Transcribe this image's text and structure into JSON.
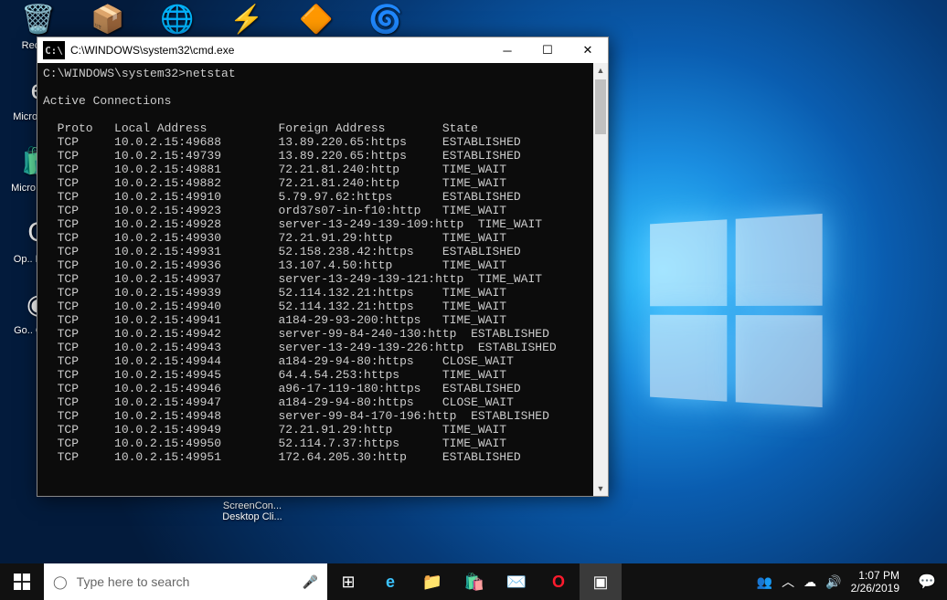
{
  "desktop": {
    "top_icons": [
      {
        "name": "recycle-bin",
        "label": "Recycle Bin",
        "glyph": "🗑️"
      },
      {
        "name": "jar",
        "label": "",
        "glyph": "📦"
      },
      {
        "name": "globe",
        "label": "",
        "glyph": "🌐"
      },
      {
        "name": "winamp",
        "label": "",
        "glyph": "⚡"
      },
      {
        "name": "vlc",
        "label": "",
        "glyph": "🔶"
      },
      {
        "name": "chrome-canary",
        "label": "",
        "glyph": "🌀"
      }
    ],
    "left_icons": [
      {
        "name": "recycle-bin",
        "label": "Recyc..",
        "glyph": "🗑️"
      },
      {
        "name": "edge",
        "label": "Micro.. Ed..",
        "glyph": "e"
      },
      {
        "name": "store",
        "label": "Micro.. Too..",
        "glyph": "🛍️"
      },
      {
        "name": "opera",
        "label": "Op.. Brow..",
        "glyph": "O"
      },
      {
        "name": "chrome",
        "label": "Go.. Chro..",
        "glyph": "◉"
      }
    ],
    "orphan_label": "ScreenCon...\nDesktop Cli..."
  },
  "cmd": {
    "title": "C:\\WINDOWS\\system32\\cmd.exe",
    "prompt": "C:\\WINDOWS\\system32>",
    "command": "netstat",
    "section_header": "Active Connections",
    "columns": [
      "Proto",
      "Local Address",
      "Foreign Address",
      "State"
    ],
    "rows": [
      [
        "TCP",
        "10.0.2.15:49688",
        "13.89.220.65:https",
        "ESTABLISHED"
      ],
      [
        "TCP",
        "10.0.2.15:49739",
        "13.89.220.65:https",
        "ESTABLISHED"
      ],
      [
        "TCP",
        "10.0.2.15:49881",
        "72.21.81.240:http",
        "TIME_WAIT"
      ],
      [
        "TCP",
        "10.0.2.15:49882",
        "72.21.81.240:http",
        "TIME_WAIT"
      ],
      [
        "TCP",
        "10.0.2.15:49910",
        "5.79.97.62:https",
        "ESTABLISHED"
      ],
      [
        "TCP",
        "10.0.2.15:49923",
        "ord37s07-in-f10:http",
        "TIME_WAIT"
      ],
      [
        "TCP",
        "10.0.2.15:49928",
        "server-13-249-139-109:http",
        "TIME_WAIT"
      ],
      [
        "TCP",
        "10.0.2.15:49930",
        "72.21.91.29:http",
        "TIME_WAIT"
      ],
      [
        "TCP",
        "10.0.2.15:49931",
        "52.158.238.42:https",
        "ESTABLISHED"
      ],
      [
        "TCP",
        "10.0.2.15:49936",
        "13.107.4.50:http",
        "TIME_WAIT"
      ],
      [
        "TCP",
        "10.0.2.15:49937",
        "server-13-249-139-121:http",
        "TIME_WAIT"
      ],
      [
        "TCP",
        "10.0.2.15:49939",
        "52.114.132.21:https",
        "TIME_WAIT"
      ],
      [
        "TCP",
        "10.0.2.15:49940",
        "52.114.132.21:https",
        "TIME_WAIT"
      ],
      [
        "TCP",
        "10.0.2.15:49941",
        "a184-29-93-200:https",
        "TIME_WAIT"
      ],
      [
        "TCP",
        "10.0.2.15:49942",
        "server-99-84-240-130:http",
        "ESTABLISHED"
      ],
      [
        "TCP",
        "10.0.2.15:49943",
        "server-13-249-139-226:http",
        "ESTABLISHED"
      ],
      [
        "TCP",
        "10.0.2.15:49944",
        "a184-29-94-80:https",
        "CLOSE_WAIT"
      ],
      [
        "TCP",
        "10.0.2.15:49945",
        "64.4.54.253:https",
        "TIME_WAIT"
      ],
      [
        "TCP",
        "10.0.2.15:49946",
        "a96-17-119-180:https",
        "ESTABLISHED"
      ],
      [
        "TCP",
        "10.0.2.15:49947",
        "a184-29-94-80:https",
        "CLOSE_WAIT"
      ],
      [
        "TCP",
        "10.0.2.15:49948",
        "server-99-84-170-196:http",
        "ESTABLISHED"
      ],
      [
        "TCP",
        "10.0.2.15:49949",
        "72.21.91.29:http",
        "TIME_WAIT"
      ],
      [
        "TCP",
        "10.0.2.15:49950",
        "52.114.7.37:https",
        "TIME_WAIT"
      ],
      [
        "TCP",
        "10.0.2.15:49951",
        "172.64.205.30:http",
        "ESTABLISHED"
      ]
    ]
  },
  "taskbar": {
    "search_placeholder": "Type here to search",
    "time": "1:07 PM",
    "date": "2/26/2019"
  }
}
